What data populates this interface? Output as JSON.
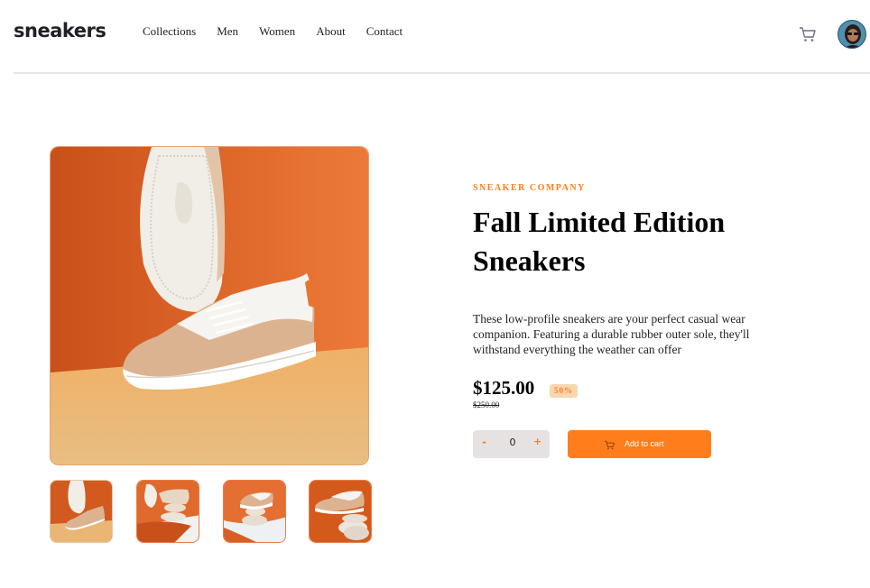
{
  "header": {
    "logo": "sneakers",
    "nav": [
      "Collections",
      "Men",
      "Women",
      "About",
      "Contact"
    ],
    "cart_icon": "cart-icon",
    "avatar_icon": "avatar"
  },
  "gallery": {
    "main_image": "sneaker-sole-and-shoe-photo",
    "thumbnails": [
      "thumbnail-1",
      "thumbnail-2",
      "thumbnail-3",
      "thumbnail-4"
    ]
  },
  "product": {
    "company": "SNEAKER COMPANY",
    "title": "Fall Limited Edition Sneakers",
    "description": "These low-profile sneakers are your perfect casual wear companion. Featuring a durable rubber outer sole, they'll withstand everything the weather can offer",
    "price": "$125.00",
    "discount": "50%",
    "old_price": "$250.00"
  },
  "cart_controls": {
    "minus": "-",
    "quantity": "0",
    "plus": "+",
    "add_label": "Add to cart"
  },
  "colors": {
    "accent": "#ff7e1b",
    "accent_pale": "#f8d6b0",
    "text_dark": "#1d2025"
  }
}
